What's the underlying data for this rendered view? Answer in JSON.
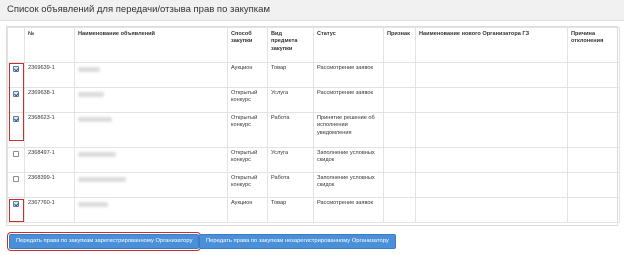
{
  "page_title": "Список объявлений для передачи/отзыва прав по закупкам",
  "table": {
    "columns": [
      "",
      "№",
      "Наименование объявлений",
      "Способ закупки",
      "Вид предмета закупки",
      "Статус",
      "Признак",
      "Наименование нового Организатора ГЗ",
      "Причина отклонения"
    ],
    "rows": [
      {
        "checked": true,
        "number": "2369639-1",
        "method": "Аукцион",
        "subject": "Товар",
        "status": "Рассмотрение заявок"
      },
      {
        "checked": true,
        "number": "2369638-1",
        "method": "Открытый конкурс",
        "subject": "Услуга",
        "status": "Рассмотрение заявок"
      },
      {
        "checked": true,
        "number": "2368623-1",
        "method": "Открытый конкурс",
        "subject": "Работа",
        "status": "Принятие решение об исполнении уведомления"
      },
      {
        "checked": false,
        "number": "2368497-1",
        "method": "Открытый конкурс",
        "subject": "Услуга",
        "status": "Заполнение условных скидок"
      },
      {
        "checked": false,
        "number": "2368399-1",
        "method": "Открытый конкурс",
        "subject": "Работа",
        "status": "Заполнение условных скидок"
      },
      {
        "checked": true,
        "number": "2367760-1",
        "method": "Аукцион",
        "subject": "Товар",
        "status": "Рассмотрение заявок"
      }
    ]
  },
  "buttons": {
    "transfer_registered": "Передать права по закупкам зарегистрированному Организатору",
    "transfer_unregistered": "Передать права по закупкам незарегистрированному Организатору"
  },
  "colors": {
    "button_blue": "#4a90d9",
    "highlight_red": "#c9302c",
    "header_bg": "#f1f1f1"
  }
}
